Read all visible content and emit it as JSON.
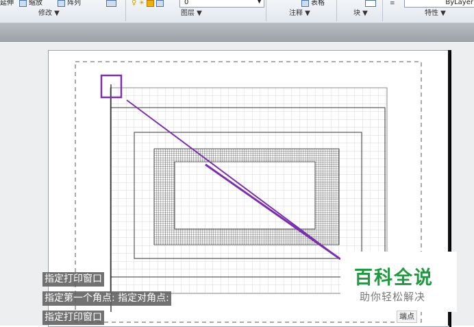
{
  "ribbon": {
    "tools": {
      "partial_left": "延伸",
      "scale": "缩放",
      "array": "阵列",
      "partial_table": "表格",
      "layer_value": "0",
      "lineweight": "ByLayer"
    },
    "panels": {
      "modify": "修改 ▼",
      "layers": "图层 ▼",
      "annotation": "注释 ▼",
      "block": "块 ▼",
      "properties": "特性 ▼"
    }
  },
  "command_lines": [
    "指定打印窗口",
    "指定第一个角点: 指定对角点:",
    "指定打印窗口"
  ],
  "tooltip": {
    "endpoint": "端点"
  },
  "watermark": {
    "title": "百科全说",
    "subtitle": "助你轻松解决"
  },
  "colors": {
    "selection": "#7b2fb0",
    "ribbon_bg": "#e8ecf1",
    "strip_bg": "#a9adb2",
    "watermark_green": "#1f9a3e"
  }
}
